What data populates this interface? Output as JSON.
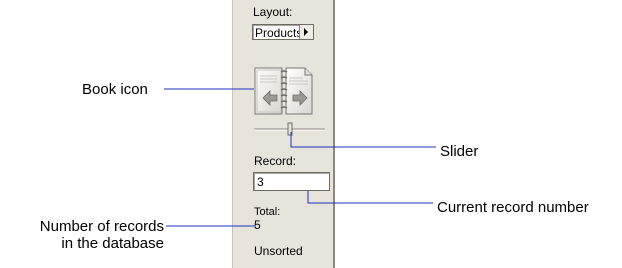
{
  "status_area": {
    "layout_label": "Layout:",
    "layout_value": "Products",
    "record_label": "Record:",
    "record_value": "3",
    "total_label": "Total:",
    "total_value": "5",
    "sort_status": "Unsorted",
    "book_icon": "book-icon",
    "slider_icon": "slider"
  },
  "callouts": {
    "book_icon": "Book icon",
    "slider": "Slider",
    "current_record": "Current record number",
    "records_line1": "Number of records",
    "records_line2": "in the database"
  },
  "colors": {
    "leader_line": "#1f2fbf",
    "panel": "#e7e4dc"
  }
}
